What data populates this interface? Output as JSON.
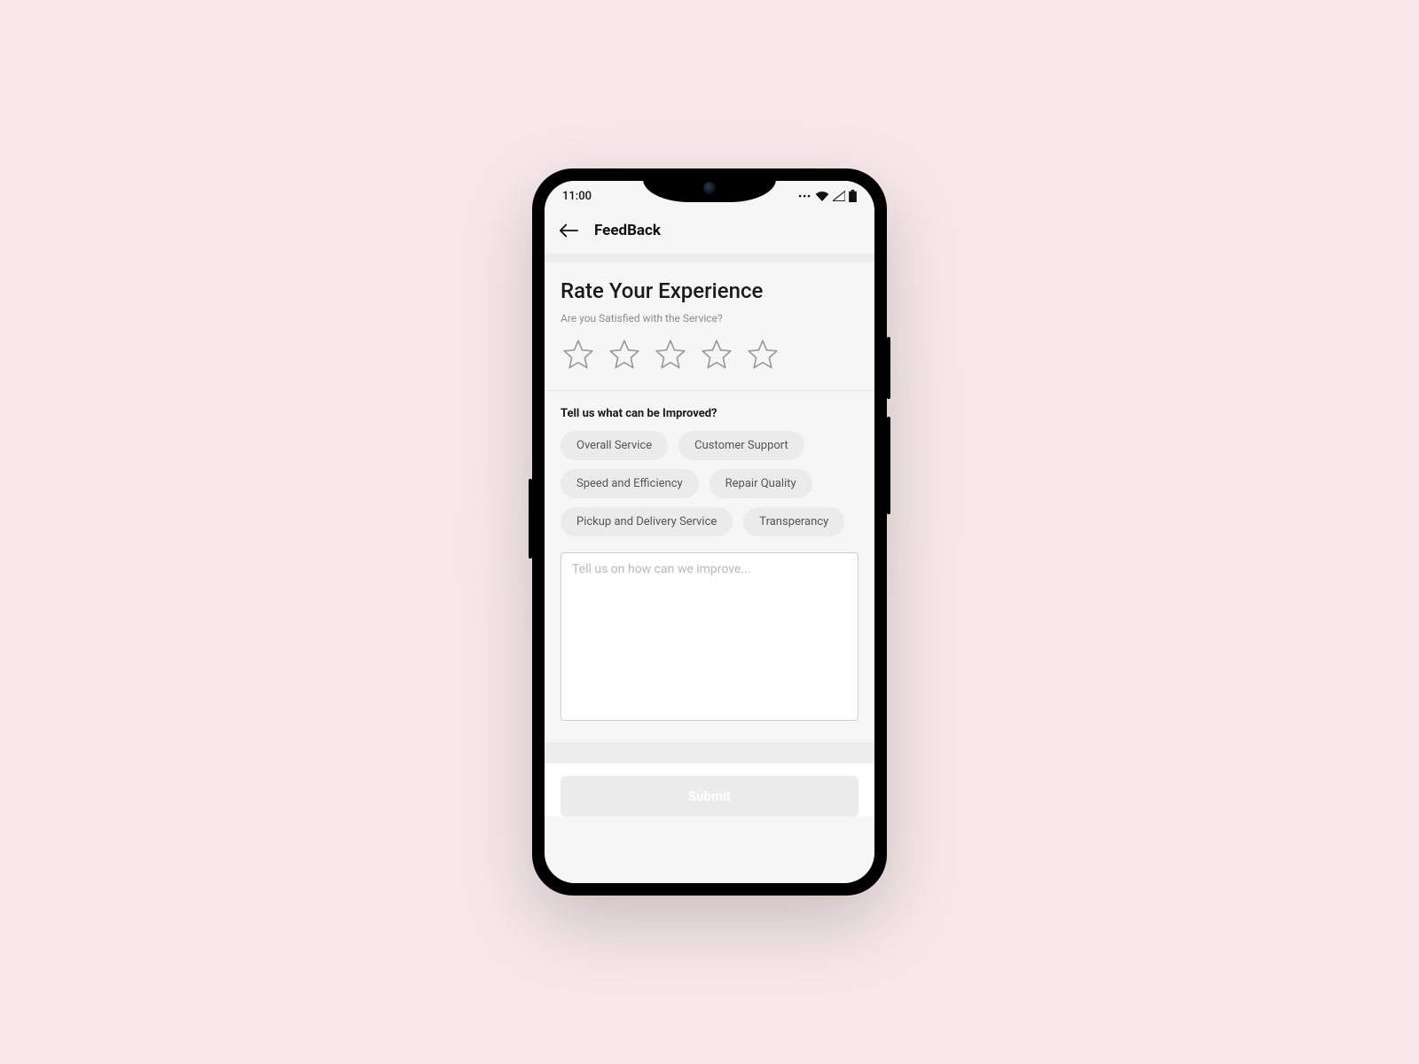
{
  "status": {
    "time": "11:00"
  },
  "header": {
    "title": "FeedBack"
  },
  "rate": {
    "title": "Rate Your Experience",
    "subtitle": "Are you Satisfied with the Service?",
    "star_count": 5
  },
  "improve": {
    "title": "Tell us what can be Improved?",
    "chips": [
      "Overall Service",
      "Customer Support",
      "Speed and Efficiency",
      "Repair Quality",
      "Pickup and Delivery Service",
      "Transperancy"
    ],
    "textarea_placeholder": "Tell us on how can we improve..."
  },
  "submit": {
    "label": "Submit"
  }
}
